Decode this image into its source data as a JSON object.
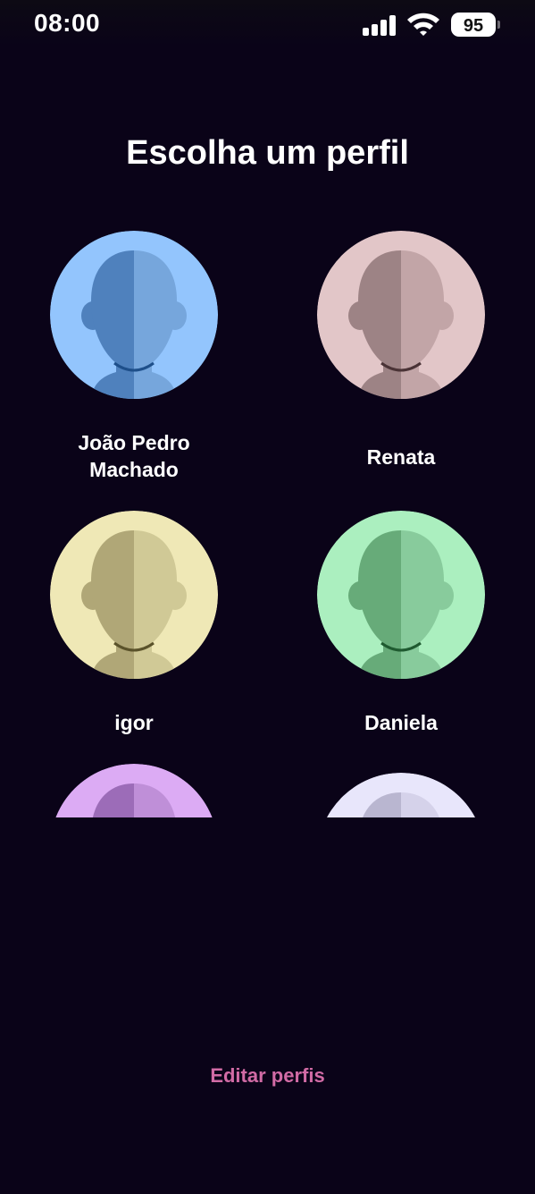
{
  "status_bar": {
    "time": "08:00",
    "battery": "95",
    "icons": [
      "signal-bars-icon",
      "wifi-icon",
      "battery-icon"
    ]
  },
  "title": "Escolha um perfil",
  "profiles": [
    {
      "name_line1": "João Pedro",
      "name_line2": "Machado",
      "bg": "#93c5fd",
      "dark": "#4f81bd",
      "light": "#76a6dc",
      "neck": "#1e4f8a"
    },
    {
      "name": "Renata",
      "bg": "#e2c6c8",
      "dark": "#9d8385",
      "light": "#c2a5a7",
      "neck": "#4a3336"
    },
    {
      "name": "igor",
      "bg": "#efe8b6",
      "dark": "#b0a777",
      "light": "#d0c996",
      "neck": "#5a522a"
    },
    {
      "name": "Daniela",
      "bg": "#abefbf",
      "dark": "#67ab79",
      "light": "#88cb9c",
      "neck": "#1f5a30"
    },
    {
      "name": "",
      "bg": "#dcabf4",
      "dark": "#9c6cb8",
      "light": "#bf8fd8",
      "neck": "#4a2a60"
    },
    {
      "name": "",
      "bg": "#e8e6fb",
      "dark": "#b9b6d0",
      "light": "#d5d2ea",
      "neck": "#55526a"
    }
  ],
  "edit_button": "Editar perfis"
}
